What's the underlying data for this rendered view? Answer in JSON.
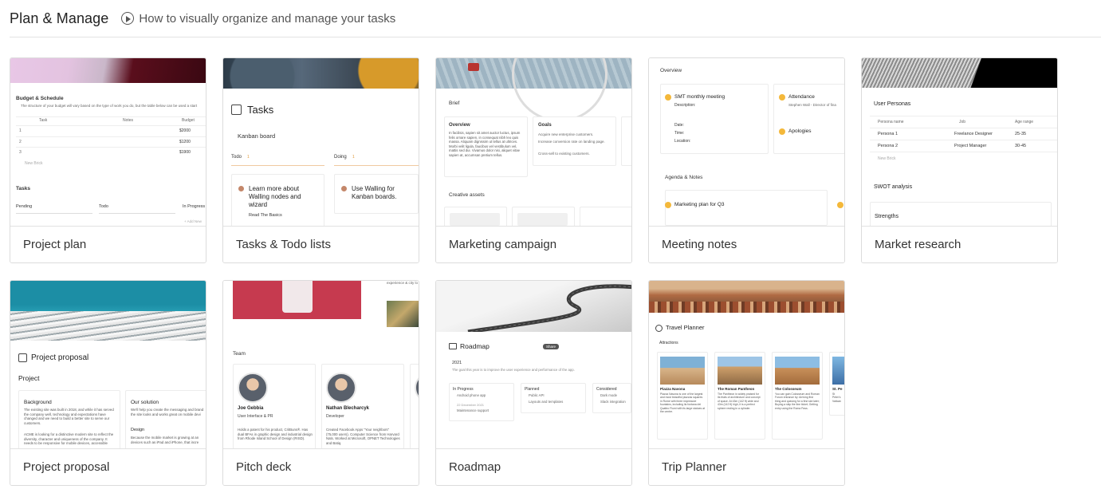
{
  "header": {
    "title": "Plan & Manage",
    "link": "How to visually organize and manage your tasks"
  },
  "cards": [
    {
      "label": "Project plan"
    },
    {
      "label": "Tasks & Todo lists"
    },
    {
      "label": "Marketing campaign"
    },
    {
      "label": "Meeting notes"
    },
    {
      "label": "Market research"
    },
    {
      "label": "Project proposal"
    },
    {
      "label": "Pitch deck"
    },
    {
      "label": "Roadmap"
    },
    {
      "label": "Trip Planner"
    }
  ],
  "previews": {
    "project_plan": {
      "section": "Budget & Schedule",
      "desc": "The structure of your budget will vary based on the type of work you do, but the table below can be used a start",
      "cols": [
        "Task",
        "Notes",
        "Budget"
      ],
      "rows": [
        {
          "n": "1",
          "budget": "$2000"
        },
        {
          "n": "2",
          "budget": "$1200"
        },
        {
          "n": "3",
          "budget": "$1900"
        }
      ],
      "new_brick": "New Brick",
      "tasks": "Tasks",
      "lanes": [
        "Pending",
        "Todo",
        "In Progress"
      ],
      "add_new": "+ Add New"
    },
    "tasks": {
      "title": "Tasks",
      "board": "Kanban board",
      "todo": "Todo",
      "todo_count": "1",
      "doing": "Doing",
      "doing_count": "1",
      "card1": "Learn more about Walling nodes and wizard",
      "card1_sub": "Read The Basics",
      "card2": "Use Walling for Kanban boards."
    },
    "marketing": {
      "brief": "Brief",
      "overview": "Overview",
      "overview_text": "In facilisis, sapien sit amet auctor luctus, ipsum felis ornare sapien, in consequat nibh leo quis massa. Aliquam dignissim ut tellus at ultrices. Morbi velit ligula, faucibus vel vestibulum vel, mattis sed dui. Vivamus dolor nisi, aliquet vitae sapien at, accumsan pretium tellus.",
      "goals": "Goals",
      "goal1": "Acquire new enterprise customers.",
      "goal2": "Increase conversion rate on landing page.",
      "goal3": "Cross-sell to existing customers.",
      "creative": "Creative assets"
    },
    "meeting": {
      "overview": "Overview",
      "meeting": "SMT monthly meeting",
      "description": "Description:",
      "date": "Date:",
      "time": "Time:",
      "location": "Location:",
      "attendance": "Attendance",
      "attendee": "Stephen Wall - Director of fina",
      "apologies": "Apologies",
      "agenda": "Agenda & Notes",
      "plan": "Marketing plan for Q3"
    },
    "market": {
      "personas": "User Personas",
      "cols": [
        "Persona name",
        "Job",
        "Age range"
      ],
      "rows": [
        {
          "name": "Persona 1",
          "job": "Freelance Designer",
          "age": "25-35"
        },
        {
          "name": "Persona 2",
          "job": "Project Manager",
          "age": "30-45"
        }
      ],
      "new_brick": "New Brick",
      "swot": "SWOT analysis",
      "strengths": "Strengths"
    },
    "proposal": {
      "title": "Project proposal",
      "project": "Project",
      "background": "Background",
      "bg_text1": "The existing site was built in 2018, and while it has served the company well, technology and expectations have changed and we need to build a better site to serve our customers.",
      "bg_text2": "ACME is looking for a distinctive modern site to reflect the diversity, character and uniqueness of the company. It needs to be responsive for mobile devices, accessible",
      "solution": "Our solution",
      "solution_text": "We'll help you create the messaging and brand the site looks and works great on mobile devi",
      "design": "Design",
      "design_text": "Because the mobile market is growing at an devices such as iPad and iPhone, that incre"
    },
    "pitch": {
      "team": "Team",
      "person1": "Joe Gebbia",
      "role1": "User Interface & PR",
      "bio1": "Holds a patent for his product, CritBuns®. Has dual BFAs in graphic design and industrial design from Rhode Island School of Design (RISD).",
      "person2": "Nathan Blecharcyk",
      "role2": "Developer",
      "bio2": "Created Facebook Apps \"Your neighbors\" (75,000 users). Computer Science from Harvard Nats. Worked at Microsoft, OPNET Technologies and Batiq.",
      "top_text": "experience & city lo"
    },
    "roadmap": {
      "title": "Roadmap",
      "share": "Share",
      "year": "2021",
      "desc": "The goal this year is to improve the user experience and performance of the app.",
      "inprogress": "In Progress",
      "ip1": "Android phone app",
      "ip_date": "22 December 2021",
      "ip2": "Maintenance support",
      "planned": "Planned",
      "p1": "Public API",
      "p2": "Layouts and templates",
      "considered": "Considered",
      "c1": "Dark mode",
      "c2": "Slack integration"
    },
    "trip": {
      "title": "Travel Planner",
      "attractions": "Attractions",
      "a1": "Piazza Navona",
      "a1_text": "Piazza Navona is one of the largest and most beautiful piazzas squares in Rome with three impressive fountains, including its fontana dei Quattro Fiumi with its large statues at the centre.",
      "a2": "The Roman Pantheon",
      "a2_text": "The Pantheon is widely praised for its feats of architecture and concept of space. At 43m (142 ft) wide and 43m (142 ft) high, it is a perfect sphere resting in a cylinder.",
      "a3": "The Colosseum",
      "a3_text": "You can gain Colosseum and Roman Forum entrance by: Arriving first thing and queuing for a first slot later; Buying a skip the line ticket; Getting entry using the Roma Pass.",
      "a4": "St. Pe",
      "a4_text": "St Peter's Vatican"
    }
  },
  "colors": {
    "accent_orange": "#f4b83a",
    "border": "#dcdcdc",
    "red_block": "#c63a4f"
  }
}
